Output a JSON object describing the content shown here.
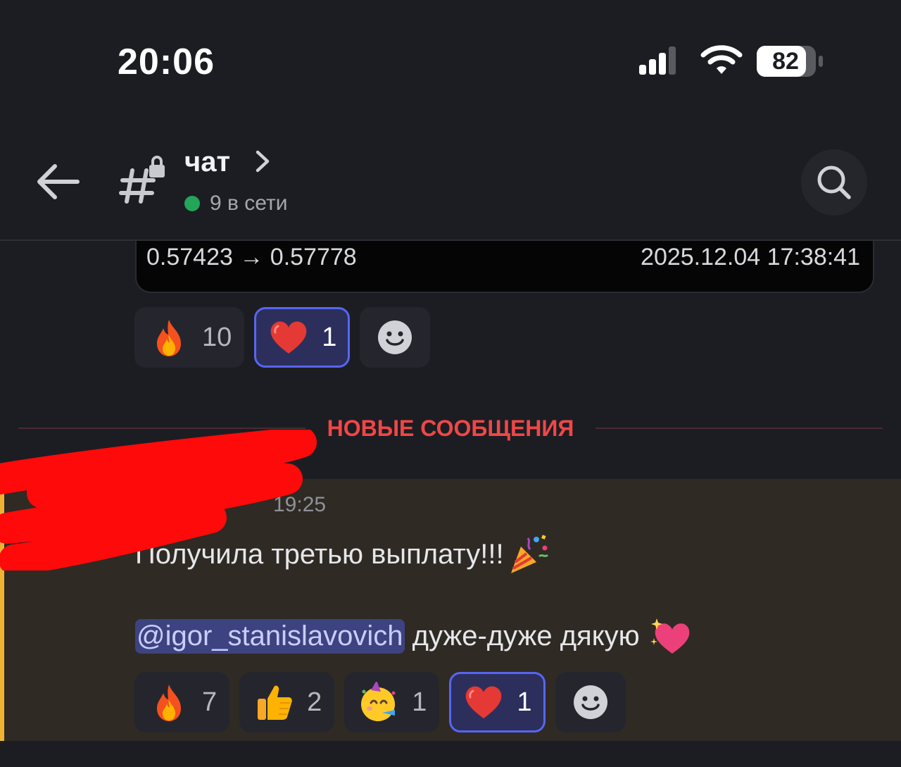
{
  "status_bar": {
    "time": "20:06",
    "battery": "82"
  },
  "header": {
    "channel_name": "чат",
    "online_text": "9 в сети"
  },
  "embed": {
    "left_text": "0.57423 → 0.57778",
    "right_text": "2025.12.04 17:38:41"
  },
  "reactions_top": [
    {
      "emoji": "fire-icon",
      "count": "10",
      "active": false
    },
    {
      "emoji": "red-heart-icon",
      "count": "1",
      "active": true
    }
  ],
  "divider": {
    "label": "НОВЫЕ СООБЩЕНИЯ"
  },
  "message": {
    "time": "19:25",
    "line1": "Получила третью выплату!!!",
    "mention": "@igor_stanislavovich",
    "line2_rest": " дуже-дуже дякую"
  },
  "reactions_bottom": [
    {
      "emoji": "fire-icon",
      "count": "7",
      "active": false
    },
    {
      "emoji": "thumbs-up-icon",
      "count": "2",
      "active": false
    },
    {
      "emoji": "partying-face-icon",
      "count": "1",
      "active": false
    },
    {
      "emoji": "red-heart-icon",
      "count": "1",
      "active": true
    }
  ],
  "colors": {
    "accent": "#5865f2",
    "new_messages": "#f04747",
    "online": "#23a55a",
    "highlight_bar": "#f0b232"
  }
}
